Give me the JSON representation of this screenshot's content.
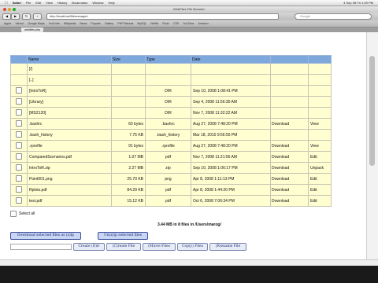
{
  "menubar": {
    "apple": "",
    "items": [
      "Safari",
      "File",
      "Edit",
      "View",
      "History",
      "Bookmarks",
      "Window",
      "Help"
    ],
    "right": "4 Sep 08  Fri 1:09 PM"
  },
  "window": {
    "title": "WebFiles File Browser"
  },
  "toolbar": {
    "url": "http://localhost/filemanager/",
    "search_placeholder": "Google"
  },
  "bookmarks": [
    "Apple",
    "Yahoo!",
    "Google Maps",
    "YouTube",
    "Wikipedia",
    "News",
    "Popular",
    "Gallery",
    "PHP Manual",
    "MySQL",
    "Netflix",
    "Flickr",
    "CSS",
    "YouTube",
    "Amazon"
  ],
  "tab": {
    "label": "webfiles.php"
  },
  "table": {
    "headers": [
      "",
      "Name",
      "Size",
      "Type",
      "Date",
      "",
      ""
    ],
    "rows": [
      {
        "name": "[/]",
        "size": "",
        "type": "",
        "date": "",
        "a1": "",
        "a2": ""
      },
      {
        "name": "[..]",
        "size": "",
        "type": "",
        "date": "",
        "a1": "",
        "a2": ""
      },
      {
        "name": "[IntroToR]",
        "size": "",
        "type": "DIR",
        "date": "Sep 10, 2008 1:08:41 PM",
        "a1": "",
        "a2": ""
      },
      {
        "name": "[Library]",
        "size": "",
        "type": "DIR",
        "date": "Sep 4, 2008 11:56:30 AM",
        "a1": "",
        "a2": ""
      },
      {
        "name": "[MS2120]",
        "size": "",
        "type": "DIR",
        "date": "Nov 7, 2008 11:32:22 AM",
        "a1": "",
        "a2": ""
      },
      {
        "name": ".bashrc",
        "size": "60 bytes",
        "type": ".bashrc",
        "date": "Aug 27, 2008 7:48:20 PM",
        "a1": "Download",
        "a2": "View"
      },
      {
        "name": ".bash_history",
        "size": "7.75 KB",
        "type": ".bash_history",
        "date": "Mar 18, 2010 9:56:55 PM",
        "a1": "",
        "a2": ""
      },
      {
        "name": ".rprofile",
        "size": "91 bytes",
        "type": ".rprofile",
        "date": "Aug 27, 2008 7:48:20 PM",
        "a1": "Download",
        "a2": "View"
      },
      {
        "name": "ComparedScenarios.pdf",
        "size": "1.07 MB",
        "type": "pdf",
        "date": "Nov 7, 2008 11:21:56 AM",
        "a1": "Download",
        "a2": "Edit"
      },
      {
        "name": "IntroToR.zip",
        "size": "2.27 MB",
        "type": "zip",
        "date": "Sep 10, 2008 1:06:17 PM",
        "a1": "Download",
        "a2": "Unpack"
      },
      {
        "name": "Point001.png",
        "size": "25.70 KB",
        "type": "png",
        "date": "Apr 8, 2008 1:11:13 PM",
        "a1": "Download",
        "a2": "Edit"
      },
      {
        "name": "Rplots.pdf",
        "size": "84.29 KB",
        "type": "pdf",
        "date": "Apr 8, 2008 1:44:20 PM",
        "a1": "Download",
        "a2": "Edit"
      },
      {
        "name": "test.pdf",
        "size": "15.12 KB",
        "type": "pdf",
        "date": "Oct 6, 2008 7:06:34 PM",
        "a1": "Download",
        "a2": "Edit"
      }
    ]
  },
  "select_all": "Select all",
  "summary": "3.44 MB in 8 files in /Users/marog/",
  "buttons": {
    "download_zip": "Download selected files as (z)ip",
    "unzip": "Un(z)ip selected files",
    "create_dir": "Create (D)ir",
    "create_file": "(C)reate File",
    "move_files": "(M)ove Files",
    "copy_files": "Cop(y) Files",
    "rename_file": "(R)ename File"
  }
}
